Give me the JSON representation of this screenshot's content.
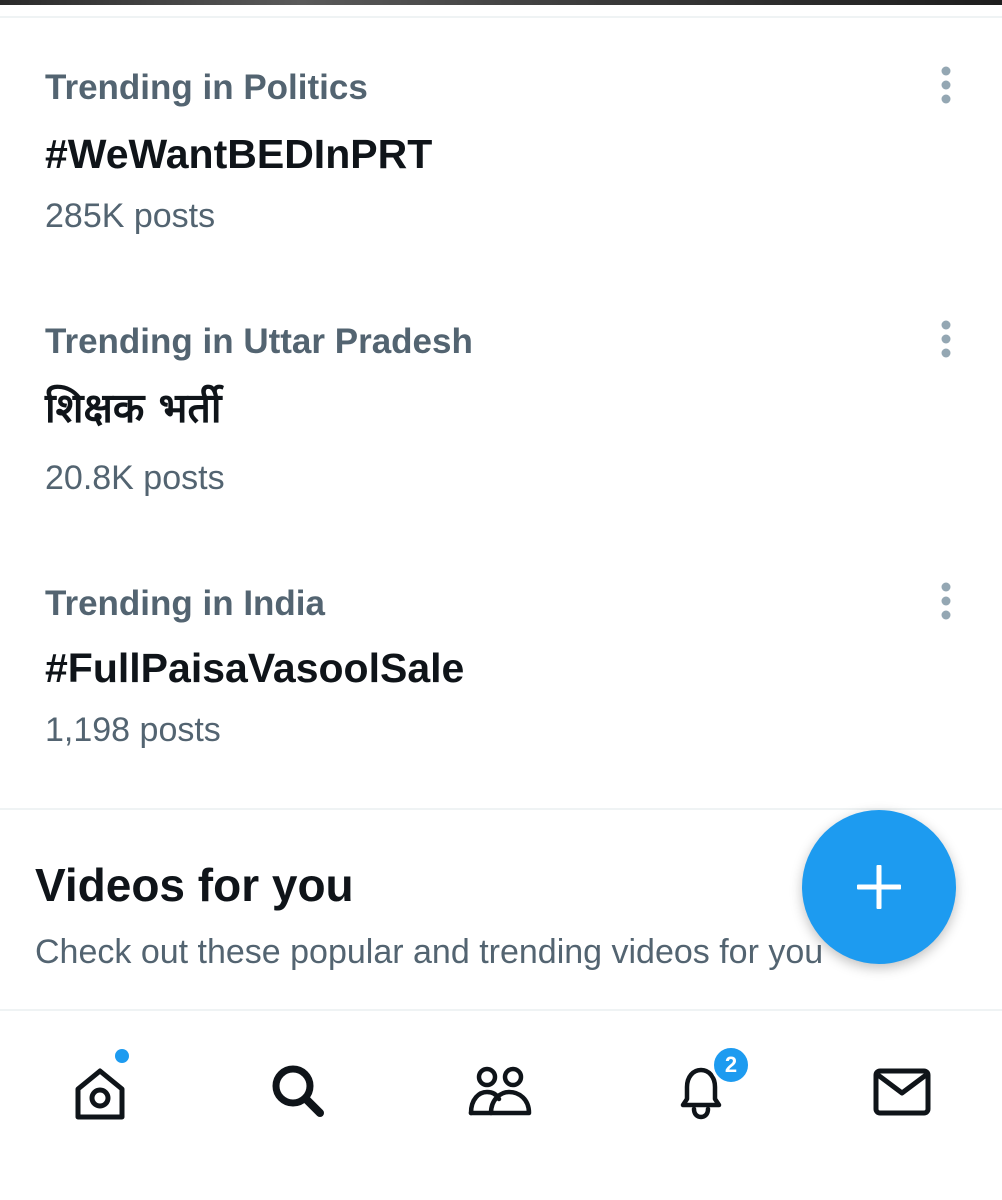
{
  "trends": [
    {
      "context": "Trending in Politics",
      "name": "#WeWantBEDInPRT",
      "posts": "285K posts"
    },
    {
      "context": "Trending in Uttar Pradesh",
      "name": "शिक्षक भर्ती",
      "posts": "20.8K posts"
    },
    {
      "context": "Trending in India",
      "name": "#FullPaisaVasoolSale",
      "posts": "1,198 posts"
    }
  ],
  "videos_section": {
    "title": "Videos for you",
    "subtitle": "Check out these popular and trending videos for you"
  },
  "bottom_nav": {
    "items": [
      "home-icon",
      "search-icon",
      "communities-icon",
      "notifications-icon",
      "messages-icon"
    ],
    "notifications_badge": "2"
  },
  "colors": {
    "accent": "#1d9bf0",
    "primary_text": "#0f1419",
    "secondary_text": "#536471",
    "divider": "#eff3f4"
  }
}
